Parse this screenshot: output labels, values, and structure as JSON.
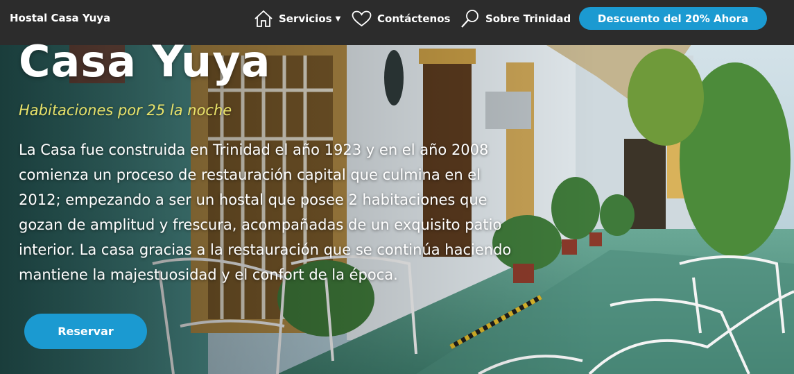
{
  "navbar": {
    "brand": "Hostal Casa Yuya",
    "items": [
      {
        "label": "Servicios",
        "icon": "home-icon",
        "has_dropdown": true
      },
      {
        "label": "Contáctenos",
        "icon": "heart-icon"
      },
      {
        "label": "Sobre Trinidad",
        "icon": "search-icon"
      }
    ],
    "cta_label": "Descuento del 20% Ahora"
  },
  "hero": {
    "title": "Casa Yuya",
    "subtitle": "Habitaciones por 25 la noche",
    "description": "La Casa fue construida en Trinidad el año 1923 y en el año 2008 comienza un proceso de restauración capital que culmina en el 2012; empezando a ser un hostal que posee 2 habitaciones que gozan de amplitud y frescura, acompañadas de un exquisito patio interior. La casa gracias a la restauración que se continúa haciendo mantiene la majestuosidad y el confort de la época.",
    "button_label": "Reservar"
  },
  "colors": {
    "navbar_bg": "#2c2c2c",
    "accent": "#1b9ad1",
    "subtitle": "#e9e36a"
  }
}
